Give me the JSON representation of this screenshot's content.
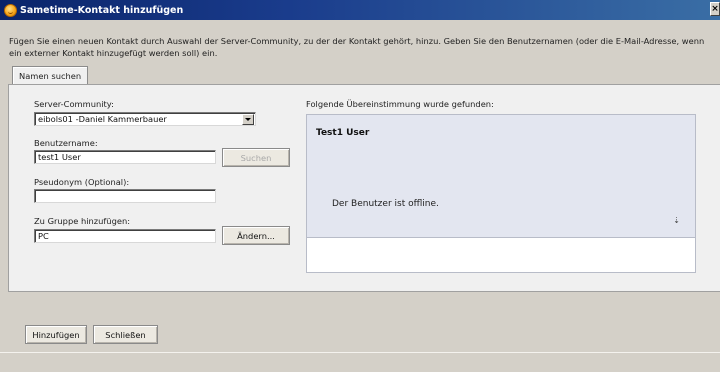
{
  "window": {
    "title": "Sametime-Kontakt hinzufügen",
    "close_glyph": "×"
  },
  "intro_text": "Fügen Sie einen neuen Kontakt durch Auswahl der Server-Community, zu der der Kontakt gehört, hinzu. Geben Sie den Benutzernamen (oder die E-Mail-Adresse, wenn ein externer Kontakt hinzugefügt werden soll) ein.",
  "tabs": [
    {
      "label": "Namen suchen",
      "selected": true
    }
  ],
  "form": {
    "community_label": "Server-Community:",
    "community_value": "eibols01 -Daniel Kammerbauer",
    "username_label": "Benutzername:",
    "username_value": "test1 User",
    "search_button": "Suchen",
    "pseudonym_label": "Pseudonym (Optional):",
    "pseudonym_value": "",
    "group_label": "Zu Gruppe hinzufügen:",
    "group_value": "PC",
    "change_button": "Ändern..."
  },
  "results": {
    "heading": "Folgende Übereinstimmung wurde gefunden:",
    "match_name": "Test1 User",
    "match_status": "Der Benutzer ist offline.",
    "scroll_glyph": "⇣"
  },
  "actions": {
    "add_button": "Hinzufügen",
    "close_button": "Schließen"
  },
  "colors": {
    "titlebar": "#0a246a",
    "match_background": "#e3e6f0",
    "dialog_background": "#d4d0c8"
  }
}
